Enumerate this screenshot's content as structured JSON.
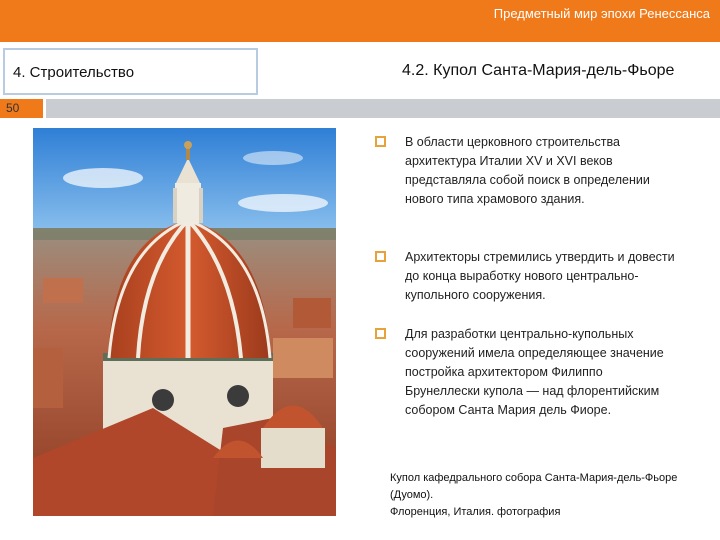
{
  "header": {
    "title": "Предметный мир эпохи Ренессанса"
  },
  "section": {
    "label": "4. Строительство"
  },
  "slide": {
    "title": "4.2. Купол Санта-Мария-дель-Фьоре",
    "page_number": "50"
  },
  "bullets": [
    {
      "text": "В области церковного строительства архитектура Италии XV и XVI веков представляла собой поиск в определении нового типа храмового здания."
    },
    {
      "text": "Архитекторы стремились утвердить и довести до конца выработку нового центрально-купольного сооружения."
    },
    {
      "text": "Для разработки центрально-купольных сооружений имела определяющее значение постройка архитектором Филиппо Брунеллески купола — над флорентийским собором Санта Мария дель Фиоре."
    }
  ],
  "caption": {
    "line1": "Купол кафедрального собора Санта-Мария-дель-Фьоре (Дуомо).",
    "line2": "Флоренция, Италия. фотография"
  },
  "colors": {
    "accent": "#f07a1a",
    "gray_bar": "#c9ccd1",
    "box_border": "#b8cbe0",
    "bullet": "#e8a23a"
  },
  "icons": {
    "bullet": "hollow-square-bullet-icon"
  }
}
